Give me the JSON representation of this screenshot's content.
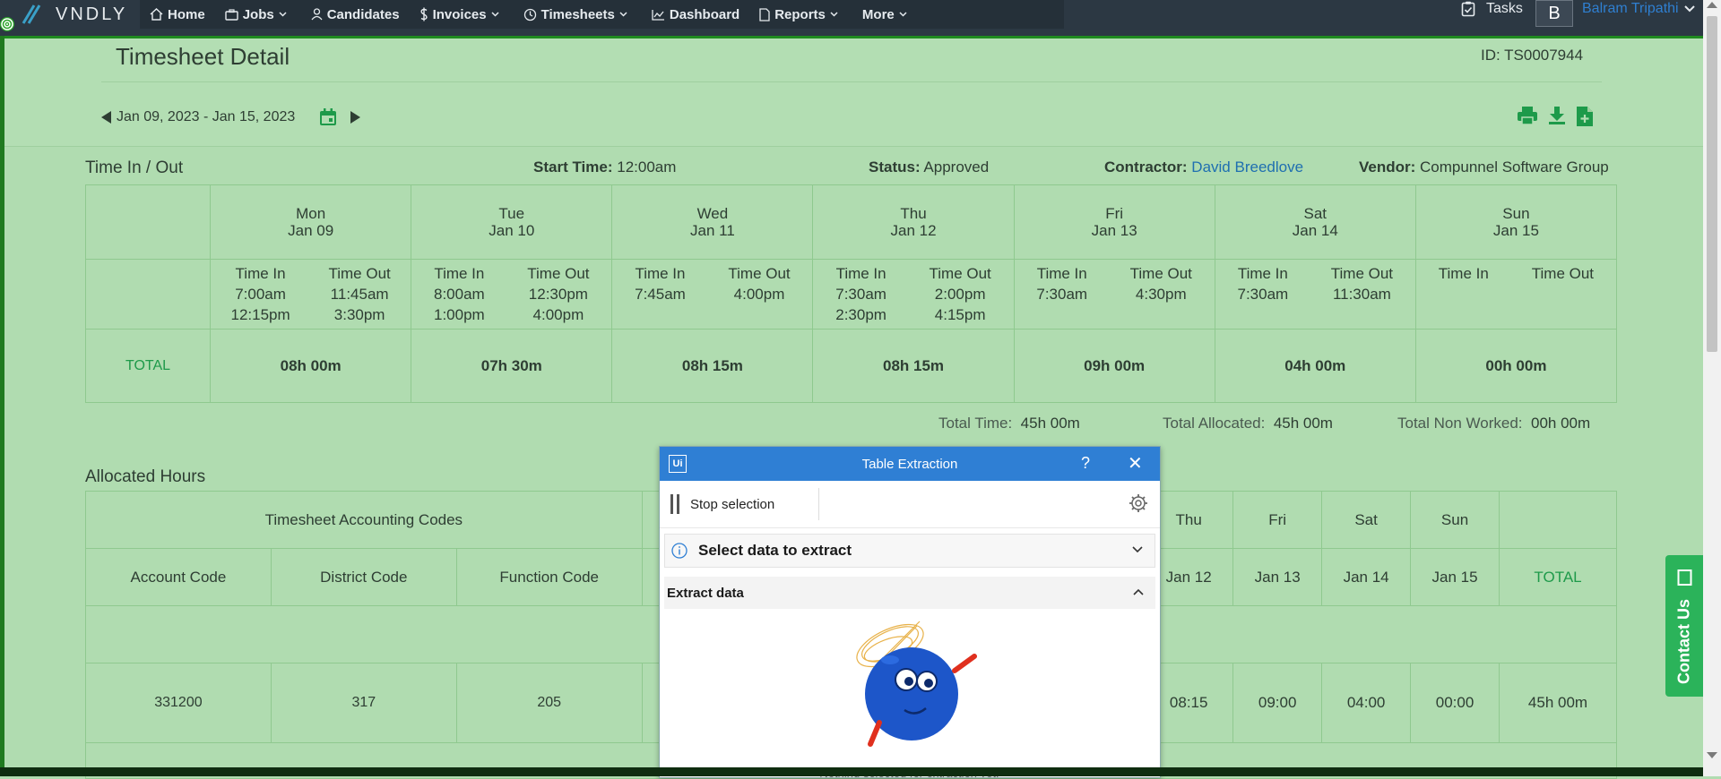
{
  "brand": {
    "name": "VNDLY"
  },
  "nav": {
    "items": [
      {
        "label": "Home",
        "icon": "home-icon"
      },
      {
        "label": "Jobs",
        "icon": "briefcase-icon",
        "caret": true
      },
      {
        "label": "Candidates",
        "icon": "person-icon"
      },
      {
        "label": "Invoices",
        "icon": "dollar-icon",
        "caret": true
      },
      {
        "label": "Timesheets",
        "icon": "clock-icon",
        "caret": true
      },
      {
        "label": "Dashboard",
        "icon": "chart-icon"
      },
      {
        "label": "Reports",
        "icon": "document-icon",
        "caret": true
      },
      {
        "label": "More",
        "icon": "",
        "caret": true
      }
    ],
    "tasks": "Tasks",
    "avatar_letter": "B",
    "user_name": "Balram Tripathi"
  },
  "header": {
    "title": "Timesheet Detail",
    "id": "ID: TS0007944",
    "date_range": "Jan 09, 2023 - Jan 15, 2023"
  },
  "time_in_out": {
    "title": "Time In / Out",
    "start_time_label": "Start Time:",
    "start_time": "12:00am",
    "status_label": "Status:",
    "status": "Approved",
    "contractor_label": "Contractor:",
    "contractor": "David Breedlove",
    "vendor_label": "Vendor:",
    "vendor": "Compunnel Software Group",
    "time_in_label": "Time In",
    "time_out_label": "Time Out",
    "total_label": "TOTAL",
    "days": [
      {
        "dow": "Mon",
        "date": "Jan 09",
        "ins": [
          "7:00am",
          "12:15pm"
        ],
        "outs": [
          "11:45am",
          "3:30pm"
        ],
        "total": "08h 00m"
      },
      {
        "dow": "Tue",
        "date": "Jan 10",
        "ins": [
          "8:00am",
          "1:00pm"
        ],
        "outs": [
          "12:30pm",
          "4:00pm"
        ],
        "total": "07h 30m"
      },
      {
        "dow": "Wed",
        "date": "Jan 11",
        "ins": [
          "7:45am"
        ],
        "outs": [
          "4:00pm"
        ],
        "total": "08h 15m"
      },
      {
        "dow": "Thu",
        "date": "Jan 12",
        "ins": [
          "7:30am",
          "2:30pm"
        ],
        "outs": [
          "2:00pm",
          "4:15pm"
        ],
        "total": "08h 15m"
      },
      {
        "dow": "Fri",
        "date": "Jan 13",
        "ins": [
          "7:30am"
        ],
        "outs": [
          "4:30pm"
        ],
        "total": "09h 00m"
      },
      {
        "dow": "Sat",
        "date": "Jan 14",
        "ins": [
          "7:30am"
        ],
        "outs": [
          "11:30am"
        ],
        "total": "04h 00m"
      },
      {
        "dow": "Sun",
        "date": "Jan 15",
        "ins": [],
        "outs": [],
        "total": "00h 00m"
      }
    ],
    "summary": {
      "total_time_label": "Total Time:",
      "total_time": "45h 00m",
      "total_allocated_label": "Total Allocated:",
      "total_allocated": "45h 00m",
      "total_non_worked_label": "Total Non Worked:",
      "total_non_worked": "00h 00m"
    }
  },
  "allocated": {
    "title": "Allocated Hours",
    "group_header": "Timesheet Accounting Codes",
    "columns": [
      "Account Code",
      "District Code",
      "Function Code"
    ],
    "day_headers": [
      {
        "dow": "Thu",
        "date": "Jan 12"
      },
      {
        "dow": "Fri",
        "date": "Jan 13"
      },
      {
        "dow": "Sat",
        "date": "Jan 14"
      },
      {
        "dow": "Sun",
        "date": "Jan 15"
      }
    ],
    "total_header": "TOTAL",
    "row": {
      "account": "331200",
      "district": "317",
      "function": "205",
      "days": [
        "08:15",
        "09:00",
        "04:00",
        "00:00"
      ],
      "total": "45h 00m"
    }
  },
  "dialog": {
    "logo": "Ui",
    "title": "Table Extraction",
    "help": "?",
    "close": "✕",
    "stop_selection": "Stop selection",
    "select_data": "Select data to extract",
    "extract_data": "Extract data",
    "empty_message": "Nothing selected for extraction yet."
  },
  "contact_us": "Contact Us",
  "colors": {
    "nav_bg": "#2c3843",
    "page_bg": "#b0dcb0",
    "accent_green": "#1e9a4a",
    "link_blue": "#1f6fb0",
    "dialog_blue": "#2f7fd4"
  }
}
